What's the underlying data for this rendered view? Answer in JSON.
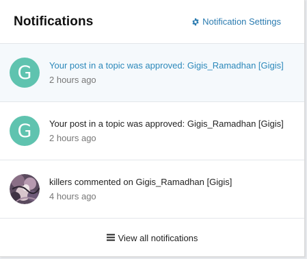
{
  "header": {
    "title": "Notifications",
    "settings_label": "Notification Settings",
    "settings_icon": "gear-icon"
  },
  "notifications": [
    {
      "avatar_letter": "G",
      "message": "Your post in a topic was approved: Gigis_Ramadhan [Gigis]",
      "time": "2 hours ago",
      "unread": true
    },
    {
      "avatar_letter": "G",
      "message": "Your post in a topic was approved: Gigis_Ramadhan [Gigis]",
      "time": "2 hours ago",
      "unread": false
    },
    {
      "avatar_image": "user-avatar-photo",
      "message": "killers commented on Gigis_Ramadhan [Gigis]",
      "time": "4 hours ago",
      "unread": false
    }
  ],
  "footer": {
    "view_all_label": "View all notifications",
    "view_all_icon": "bars-icon"
  },
  "colors": {
    "accent": "#2b7bb0",
    "avatar_bg": "#5fc3af",
    "unread_bg": "#f5f9fc"
  }
}
